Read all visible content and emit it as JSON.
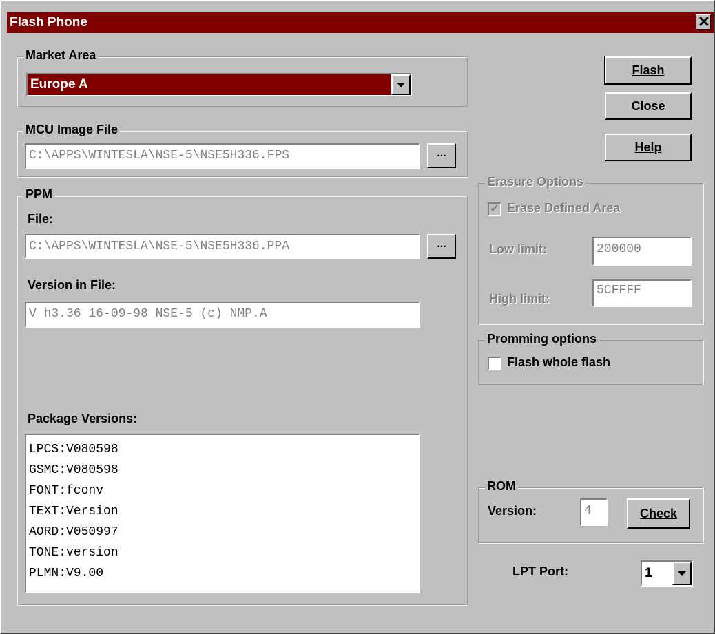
{
  "window": {
    "title": "Flash Phone",
    "close_label": "✕"
  },
  "market_area": {
    "group_label": "Market Area",
    "selected": "Europe A"
  },
  "mcu_image": {
    "group_label": "MCU Image File",
    "path": "C:\\APPS\\WINTESLA\\NSE-5\\NSE5H336.FPS",
    "browse_label": "..."
  },
  "ppm": {
    "group_label": "PPM",
    "file_label": "File:",
    "file_path": "C:\\APPS\\WINTESLA\\NSE-5\\NSE5H336.PPA",
    "browse_label": "...",
    "version_label": "Version in File:",
    "version_value": "V h3.36 16-09-98 NSE-5 (c) NMP.A",
    "package_label": "Package Versions:",
    "packages": [
      "LPCS:V080598",
      "GSMC:V080598",
      "FONT:fconv",
      "TEXT:Version",
      "AORD:V050997",
      "TONE:version",
      "PLMN:V9.00"
    ]
  },
  "buttons": {
    "flash": "Flash",
    "close": "Close",
    "help": "Help"
  },
  "erasure": {
    "group_label": "Erasure Options",
    "erase_label": "Erase Defined Area",
    "erase_checked": true,
    "low_label": "Low limit:",
    "low_value": "200000",
    "high_label": "High limit:",
    "high_value": "5CFFFF"
  },
  "promming": {
    "group_label": "Promming options",
    "flash_whole_label": "Flash whole flash",
    "flash_whole_checked": false
  },
  "rom": {
    "group_label": "ROM",
    "version_label": "Version:",
    "version_value": "4",
    "check_label": "Check"
  },
  "lpt": {
    "label": "LPT Port:",
    "selected": "1"
  },
  "colors": {
    "titlebar": "#800000",
    "face": "#c0c0c0",
    "selection": "#800000"
  }
}
